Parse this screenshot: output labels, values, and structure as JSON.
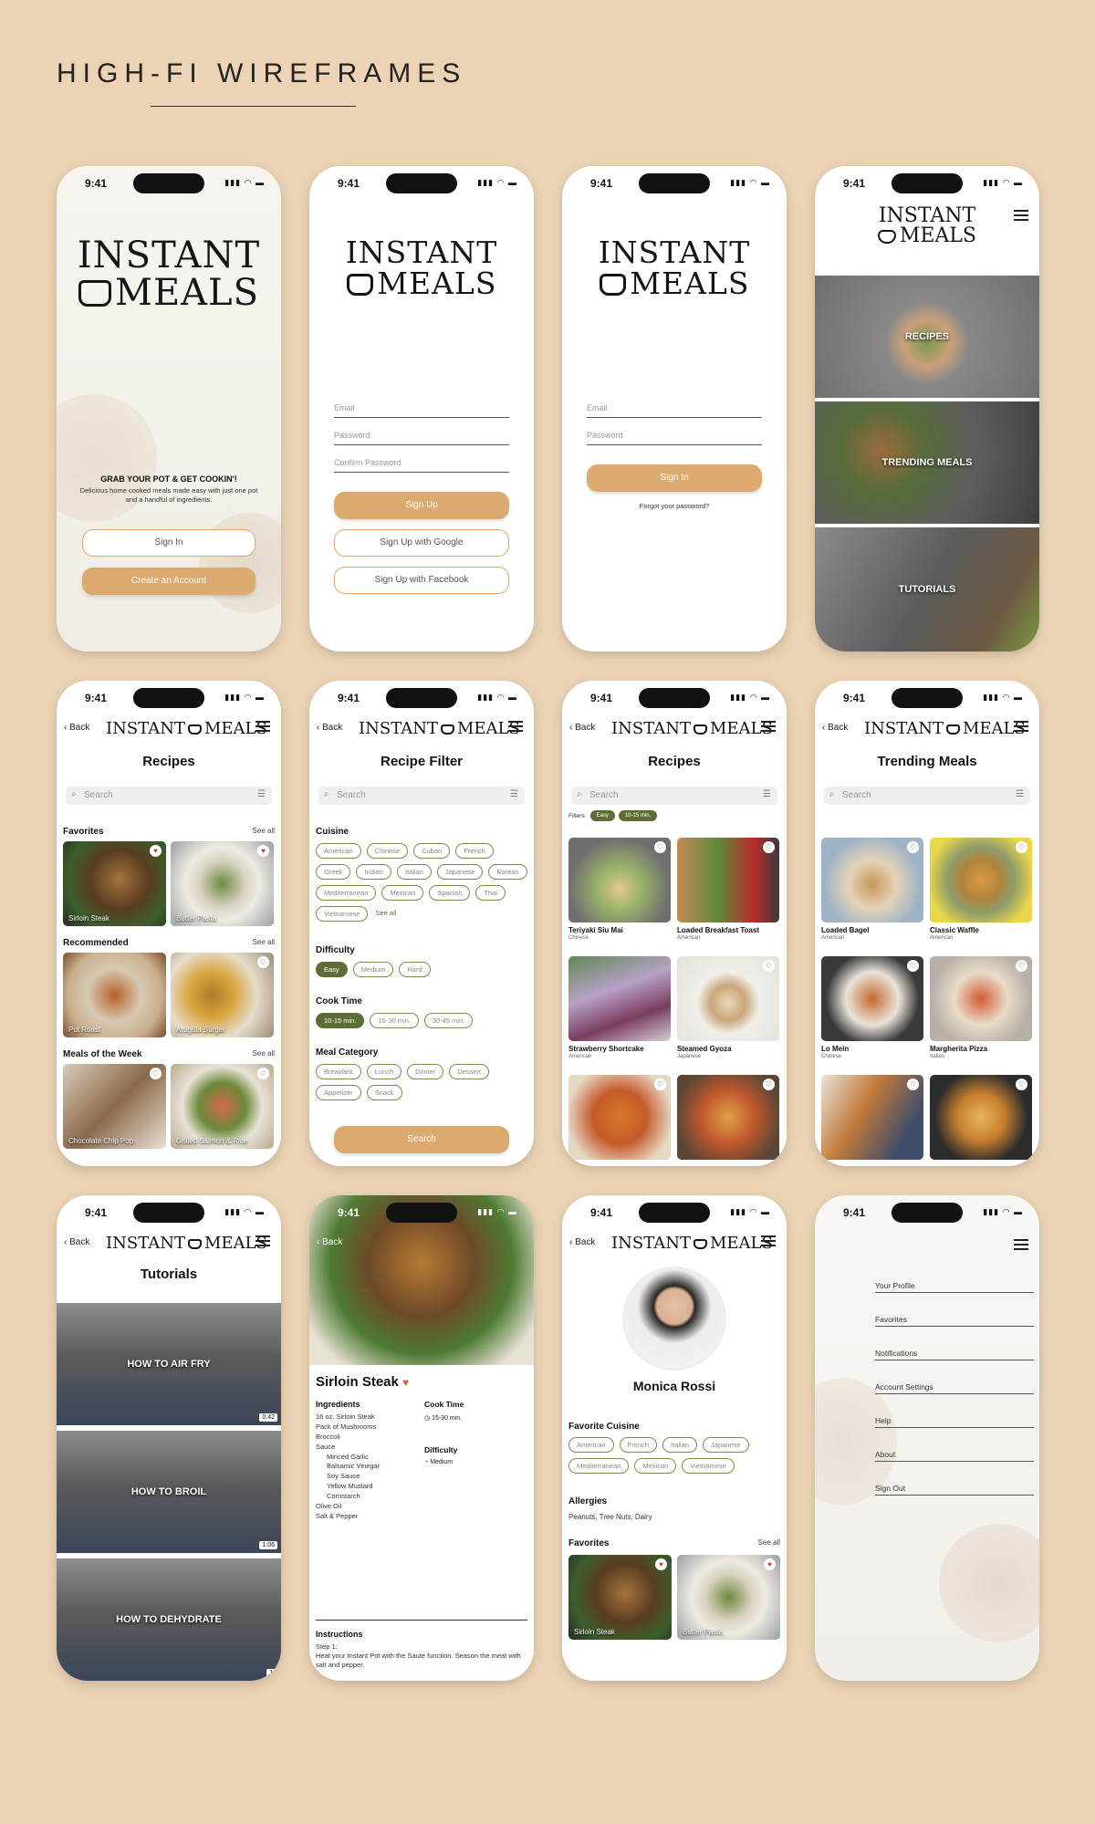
{
  "board": {
    "title": "HIGH-FI WIREFRAMES"
  },
  "status": {
    "time": "9:41",
    "icons": "▮▮▮ ◠ ▬"
  },
  "brand": {
    "line1": "INSTANT",
    "line2": "MEALS",
    "inline": "INSTANT",
    "inline2": "MEALS"
  },
  "nav": {
    "back": "Back",
    "search_placeholder": "Search",
    "see_all": "See all"
  },
  "welcome": {
    "headline": "GRAB YOUR POT & GET COOKIN'!",
    "sub": "Delicious home cooked meals made easy with just one pot and a handful of ingredients.",
    "sign_in": "Sign In",
    "create_account": "Create an Account"
  },
  "signup": {
    "email": "Email",
    "password": "Password",
    "confirm": "Confirm Password",
    "sign_up": "Sign Up",
    "google": "Sign Up with Google",
    "facebook": "Sign Up with Facebook"
  },
  "signin": {
    "email": "Email",
    "password": "Password",
    "sign_in": "Sign In",
    "forgot": "Forgot your password?"
  },
  "menu_home": {
    "recipes": "RECIPES",
    "trending": "TRENDING MEALS",
    "tutorials": "TUTORIALS"
  },
  "recipes_home": {
    "title": "Recipes",
    "favorites": "Favorites",
    "recommended": "Recommended",
    "week": "Meals of the Week",
    "fav_items": [
      "Sirloin Steak",
      "Butter Pasta"
    ],
    "rec_items": [
      "Pot Roast",
      "Arugula Burger"
    ],
    "week_items": [
      "Chocolate Chip Pop",
      "Grilled Salmon & Rice"
    ]
  },
  "filter": {
    "title": "Recipe Filter",
    "cuisine": "Cuisine",
    "cuisines": [
      "American",
      "Chinese",
      "Cuban",
      "French",
      "Greek",
      "Indian",
      "Italian",
      "Japanese",
      "Korean",
      "Mediterranean",
      "Mexican",
      "Spanish",
      "Thai",
      "Vietnamese"
    ],
    "see_all": "See all",
    "difficulty": "Difficulty",
    "difficulties": [
      "Easy",
      "Medium",
      "Hard"
    ],
    "cook_time": "Cook Time",
    "times": [
      "10-15 min.",
      "15-30 min.",
      "30-45 min."
    ],
    "category": "Meal Category",
    "categories": [
      "Breakfast",
      "Lunch",
      "Dinner",
      "Dessert",
      "Appetizer",
      "Snack"
    ],
    "search": "Search"
  },
  "results": {
    "title": "Recipes",
    "filters_label": "Filters:",
    "active": [
      "Easy",
      "10-15 min."
    ],
    "items": [
      {
        "name": "Teriyaki Siu Mai",
        "cuisine": "Chinese"
      },
      {
        "name": "Loaded Breakfast Toast",
        "cuisine": "American"
      },
      {
        "name": "Strawberry Shortcake",
        "cuisine": "American"
      },
      {
        "name": "Steamed Gyoza",
        "cuisine": "Japanese"
      }
    ]
  },
  "trending": {
    "title": "Trending Meals",
    "items": [
      {
        "name": "Loaded Bagel",
        "cuisine": "American"
      },
      {
        "name": "Classic Waffle",
        "cuisine": "American"
      },
      {
        "name": "Lo Mein",
        "cuisine": "Chinese"
      },
      {
        "name": "Margherita Pizza",
        "cuisine": "Italian"
      }
    ]
  },
  "tutorials": {
    "title": "Tutorials",
    "items": [
      {
        "label": "HOW TO AIR FRY",
        "dur": "0:42"
      },
      {
        "label": "HOW TO BROIL",
        "dur": "1:06"
      },
      {
        "label": "HOW TO DEHYDRATE",
        "dur": "1:"
      }
    ]
  },
  "detail": {
    "title": "Sirloin Steak",
    "ingredients_h": "Ingredients",
    "ingredients": [
      "16 oz. Sirloin Steak",
      "Pack of Mushrooms",
      "Broccoli",
      "Sauce",
      "Minced Garlic",
      "Balsamic Vinegar",
      "Soy Sauce",
      "Yellow Mustard",
      "Cornstarch",
      "Olive Oil",
      "Salt & Pepper"
    ],
    "cook_h": "Cook Time",
    "cook": "15-30 min.",
    "diff_h": "Difficulty",
    "diff": "Medium",
    "instr_h": "Instructions",
    "step": "Step 1:",
    "instr": "Heat your Instant Pot with the Saute function. Season the meat with salt and pepper."
  },
  "profile": {
    "name": "Monica Rossi",
    "fav_cuisine": "Favorite Cuisine",
    "cuisines": [
      "American",
      "French",
      "Italian",
      "Japanese",
      "Mediterranean",
      "Mexican",
      "Vietnamese"
    ],
    "allergies_h": "Allergies",
    "allergies": "Peanuts, Tree Nuts, Dairy",
    "favorites": "Favorites",
    "fav_items": [
      "Sirloin Steak",
      "Butter Pasta"
    ]
  },
  "side_menu": {
    "items": [
      "Your Profile",
      "Favorites",
      "Notifications",
      "Account Settings",
      "Help",
      "About",
      "Sign Out"
    ]
  },
  "colors": {
    "accent": "#dcaa6e",
    "olive": "#5e6d36",
    "background": "#ecd3b5"
  }
}
